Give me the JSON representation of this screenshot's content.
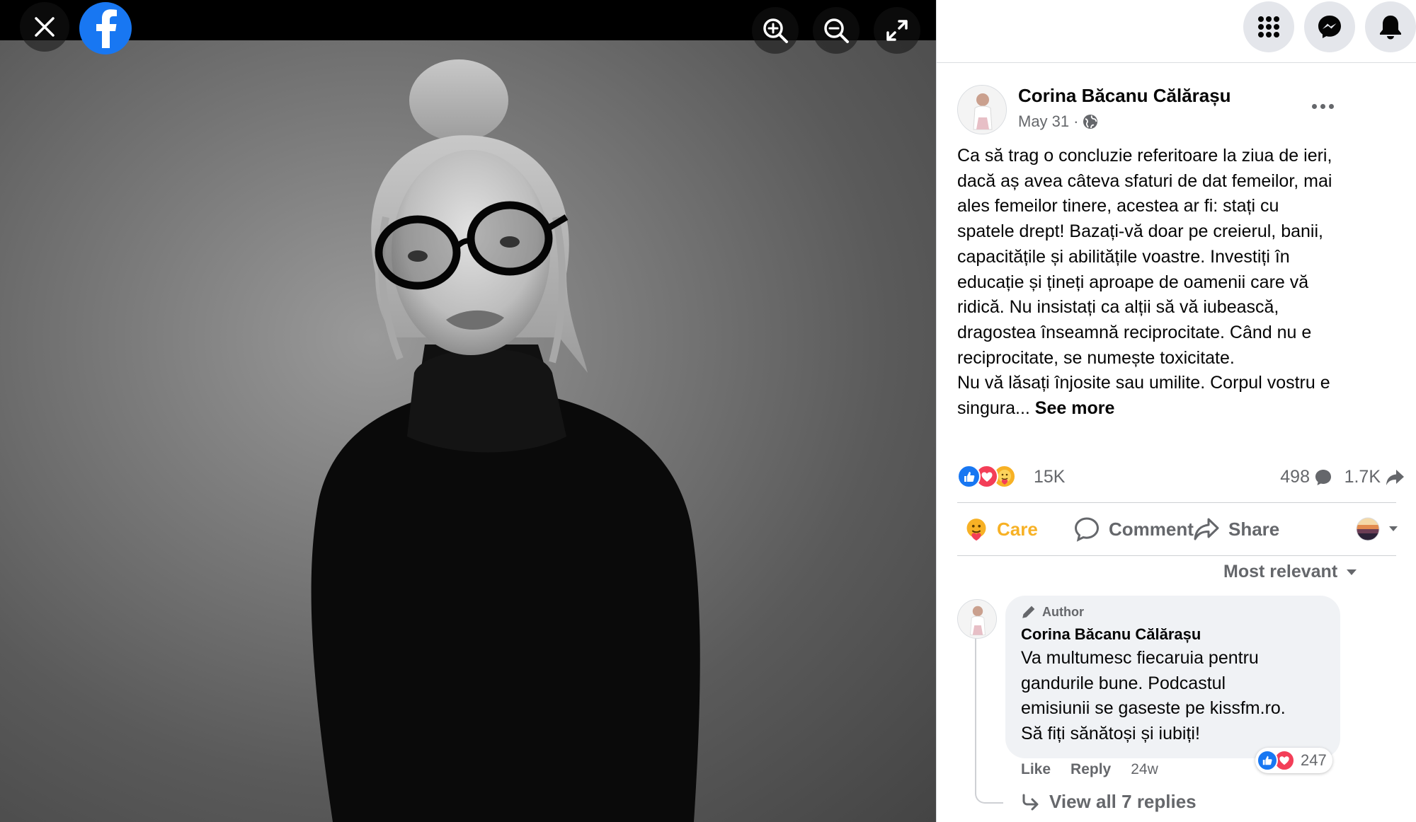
{
  "viewer": {
    "close_icon": "close-icon",
    "logo": "facebook-logo",
    "zoom_in_icon": "zoom-in-icon",
    "zoom_out_icon": "zoom-out-icon",
    "fullscreen_icon": "fullscreen-icon"
  },
  "topnav": {
    "menu_icon": "grid-menu-icon",
    "messenger_icon": "messenger-icon",
    "notifications_icon": "bell-icon"
  },
  "post": {
    "author": "Corina Băcanu Călărașu",
    "date": "May 31",
    "date_separator": "·",
    "audience_icon": "globe-icon",
    "text_lines": [
      "Ca să trag o concluzie referitoare la ziua de ieri,",
      "dacă aș avea câteva sfaturi de dat femeilor, mai",
      "ales femeilor tinere, acestea ar fi: stați cu",
      "spatele drept! Bazați-vă doar pe creierul, banii,",
      "capacitățile și abilitățile voastre. Investiți în",
      "educație și țineți aproape de oamenii care vă",
      "ridică. Nu insistați ca alții să vă iubească,",
      "dragostea înseamnă reciprocitate. Când nu e",
      "reciprocitate, se numește toxicitate.",
      "Nu vă lăsați înjosite sau umilite. Corpul vostru e"
    ],
    "text_last": "singura...",
    "see_more": "See more",
    "reactions_count": "15K",
    "comments_count": "498",
    "shares_count": "1.7K"
  },
  "actions": {
    "care": "Care",
    "comment": "Comment",
    "share": "Share"
  },
  "sort_label": "Most relevant",
  "comment": {
    "badge": "Author",
    "author": "Corina Băcanu Călărașu",
    "text_lines": [
      "Va multumesc fiecaruia pentru",
      "gandurile bune. Podcastul",
      "emisiunii se gaseste pe kissfm.ro.",
      "Să fiți sănătoși și iubiți!"
    ],
    "reactions_count": "247",
    "like": "Like",
    "reply": "Reply",
    "time": "24w",
    "view_replies": "View all 7 replies"
  },
  "colors": {
    "facebook_blue": "#1877f2",
    "care_yellow": "#f7b125",
    "love_red": "#f33e58",
    "secondary_text": "#65676b"
  }
}
